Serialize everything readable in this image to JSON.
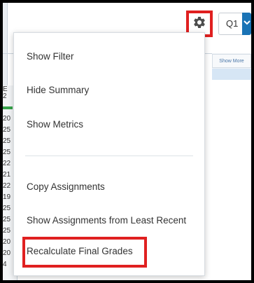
{
  "toolbar": {
    "gear_icon": "gear-icon",
    "quarter_label": "Q1",
    "dropdown_icon": "chevron-down-icon"
  },
  "background": {
    "show_more_label": "Show More",
    "column_values": [
      "E",
      "2",
      "",
      "20",
      "25",
      "25",
      "25",
      "22",
      "21",
      "22",
      "19",
      "25",
      "25",
      "25",
      "20",
      "20",
      "4"
    ]
  },
  "menu": {
    "group1": [
      {
        "label": "Show Filter"
      },
      {
        "label": "Hide Summary"
      },
      {
        "label": "Show Metrics"
      }
    ],
    "group2": [
      {
        "label": "Copy Assignments"
      },
      {
        "label": "Show Assignments from Least Recent"
      },
      {
        "label": "Recalculate Final Grades"
      }
    ]
  },
  "colors": {
    "highlight": "#e02020",
    "accent": "#1a73b5"
  }
}
